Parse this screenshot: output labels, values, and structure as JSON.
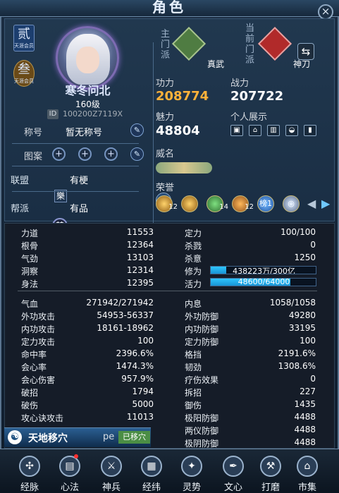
{
  "window": {
    "title": "角色",
    "close_icon": "×"
  },
  "profile": {
    "badge1_char": "贰",
    "badge1_text": "天涯会员",
    "badge2_char": "叁",
    "badge2_text": "天涯会员",
    "name": "寒冬问北",
    "level": "160级",
    "id_tag": "ID",
    "id": "100200Z7119X"
  },
  "left": {
    "title_label": "称号",
    "title_value": "暂无称号",
    "pattern_label": "图案",
    "union_label": "联盟",
    "union_icon": "樂",
    "union_value": "有梗",
    "guild_label": "帮派",
    "guild_icon": "禁",
    "guild_value": "有品",
    "plus": "+",
    "edit": "✎"
  },
  "sects": {
    "main_label": "主门派",
    "main_name": "真武",
    "current_label": "当前门派",
    "current_name": "神刀",
    "swap_icon": "⇆"
  },
  "power": {
    "merit_label": "功力",
    "merit_value": "208774",
    "combat_label": "战力",
    "combat_value": "207722",
    "charm_label": "魅力",
    "charm_value": "48804",
    "personal_label": "个人展示",
    "fame_label": "威名",
    "honor_label": "荣誉"
  },
  "honors": {
    "badge1": "12",
    "badge3": "14",
    "badge4": "12",
    "badge5": "榜1",
    "badge6": "◎"
  },
  "stats_left": [
    {
      "label": "力道",
      "value": "11553"
    },
    {
      "label": "根骨",
      "value": "12364"
    },
    {
      "label": "气劲",
      "value": "13103"
    },
    {
      "label": "洞察",
      "value": "12314"
    },
    {
      "label": "身法",
      "value": "12395"
    },
    {
      "label": "气血",
      "value": "271942/271942"
    },
    {
      "label": "外功攻击",
      "value": "54953-56337"
    },
    {
      "label": "内功攻击",
      "value": "18161-18962"
    },
    {
      "label": "定力攻击",
      "value": "100"
    },
    {
      "label": "命中率",
      "value": "2396.6%"
    },
    {
      "label": "会心率",
      "value": "1474.3%"
    },
    {
      "label": "会心伤害",
      "value": "957.9%"
    },
    {
      "label": "破招",
      "value": "1794"
    },
    {
      "label": "破伤",
      "value": "5000"
    },
    {
      "label": "攻心诀攻击",
      "value": "11013"
    }
  ],
  "stats_right": [
    {
      "label": "定力",
      "value": "100/100"
    },
    {
      "label": "杀戮",
      "value": "0"
    },
    {
      "label": "杀意",
      "value": "1250"
    },
    {
      "label": "修为",
      "value": "438223万/300亿"
    },
    {
      "label": "活力",
      "value": "48600/64000"
    },
    {
      "label": "内息",
      "value": "1058/1058"
    },
    {
      "label": "外功防御",
      "value": "49280"
    },
    {
      "label": "内功防御",
      "value": "33195"
    },
    {
      "label": "定力防御",
      "value": "100"
    },
    {
      "label": "格挡",
      "value": "2191.6%"
    },
    {
      "label": "韧劲",
      "value": "1308.6%"
    },
    {
      "label": "疗伤效果",
      "value": "0"
    },
    {
      "label": "拆招",
      "value": "227"
    },
    {
      "label": "御伤",
      "value": "1435"
    },
    {
      "label": "极阳防御",
      "value": "4488"
    },
    {
      "label": "两仪防御",
      "value": "4488"
    },
    {
      "label": "极阴防御",
      "value": "4488"
    }
  ],
  "progress": {
    "cultivation": 0.15,
    "vitality": 0.759
  },
  "skill": {
    "icon": "☯",
    "name": "天地移穴",
    "pe": "pe",
    "moved": "已移穴"
  },
  "nav": [
    {
      "label": "经脉",
      "icon": "✣"
    },
    {
      "label": "心法",
      "icon": "▤"
    },
    {
      "label": "神兵",
      "icon": "⚔"
    },
    {
      "label": "经纬",
      "icon": "▦"
    },
    {
      "label": "灵势",
      "icon": "✦"
    },
    {
      "label": "文心",
      "icon": "✒"
    },
    {
      "label": "打磨",
      "icon": "⚒"
    },
    {
      "label": "市集",
      "icon": "⌂"
    }
  ]
}
